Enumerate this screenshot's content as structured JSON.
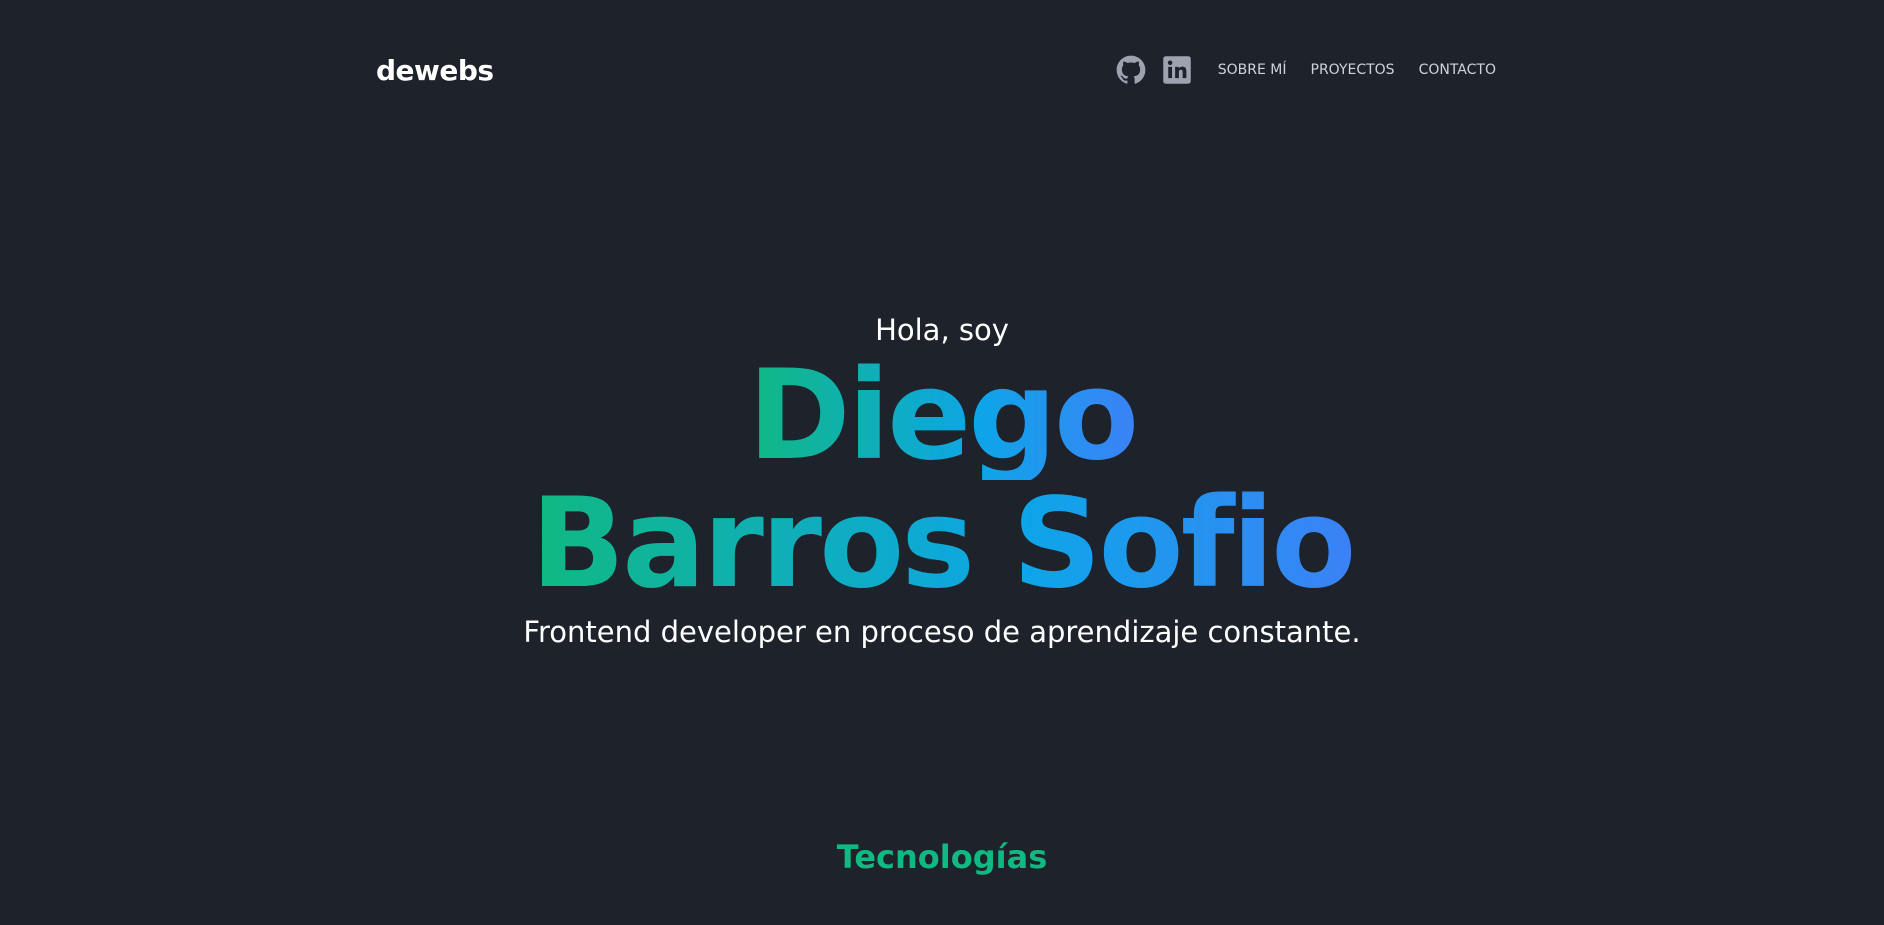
{
  "header": {
    "logo": "dewebs",
    "icons": [
      "github-icon",
      "linkedin-icon"
    ],
    "links": [
      "SOBRE MÍ",
      "PROYECTOS",
      "CONTACTO"
    ]
  },
  "hero": {
    "greeting": "Hola, soy",
    "name_line1": "Diego",
    "name_line2": "Barros Sofio",
    "tagline": "Frontend developer en proceso de aprendizaje constante."
  },
  "section": {
    "title": "Tecnologías"
  },
  "colors": {
    "background": "#1d222b",
    "accent_green": "#10b981",
    "accent_blue": "#3b82f6",
    "nav_text": "#cfd4dc",
    "icon": "#9ca3af"
  }
}
